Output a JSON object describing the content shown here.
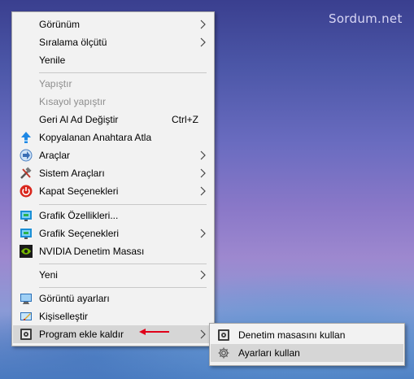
{
  "watermark": "Sordum.net",
  "main_menu": {
    "items": [
      {
        "label": "Görünüm",
        "submenu": true
      },
      {
        "label": "Sıralama ölçütü",
        "submenu": true
      },
      {
        "label": "Yenile"
      },
      {
        "label": "Yapıştır",
        "disabled": true
      },
      {
        "label": "Kısayol yapıştır",
        "disabled": true
      },
      {
        "label": "Geri Al Ad Değiştir",
        "shortcut": "Ctrl+Z"
      },
      {
        "label": "Kopyalanan Anahtara Atla",
        "icon": "regjump-arrow-icon"
      },
      {
        "label": "Araçlar",
        "icon": "tools-arrow-icon",
        "submenu": true
      },
      {
        "label": "Sistem Araçları",
        "icon": "hammer-wrench-icon",
        "submenu": true
      },
      {
        "label": "Kapat Seçenekleri",
        "icon": "power-icon",
        "submenu": true
      },
      {
        "label": "Grafik Özellikleri...",
        "icon": "intel-graphics-icon"
      },
      {
        "label": "Grafik Seçenekleri",
        "icon": "intel-graphics-icon",
        "submenu": true
      },
      {
        "label": "NVIDIA Denetim Masası",
        "icon": "nvidia-icon"
      },
      {
        "label": "Yeni",
        "submenu": true
      },
      {
        "label": "Görüntü ayarları",
        "icon": "display-icon"
      },
      {
        "label": "Kişiselleştir",
        "icon": "personalize-icon"
      },
      {
        "label": "Program ekle kaldır",
        "icon": "programs-icon",
        "submenu": true,
        "highlighted": true
      }
    ]
  },
  "sub_menu": {
    "items": [
      {
        "label": "Denetim masasını kullan",
        "icon": "programs-icon"
      },
      {
        "label": "Ayarları kullan",
        "icon": "gear-icon",
        "highlighted": true
      }
    ]
  },
  "colors": {
    "menu_bg": "#f2f2f2",
    "highlight": "#d6d6d6",
    "annotation_arrow": "#e0001a"
  }
}
